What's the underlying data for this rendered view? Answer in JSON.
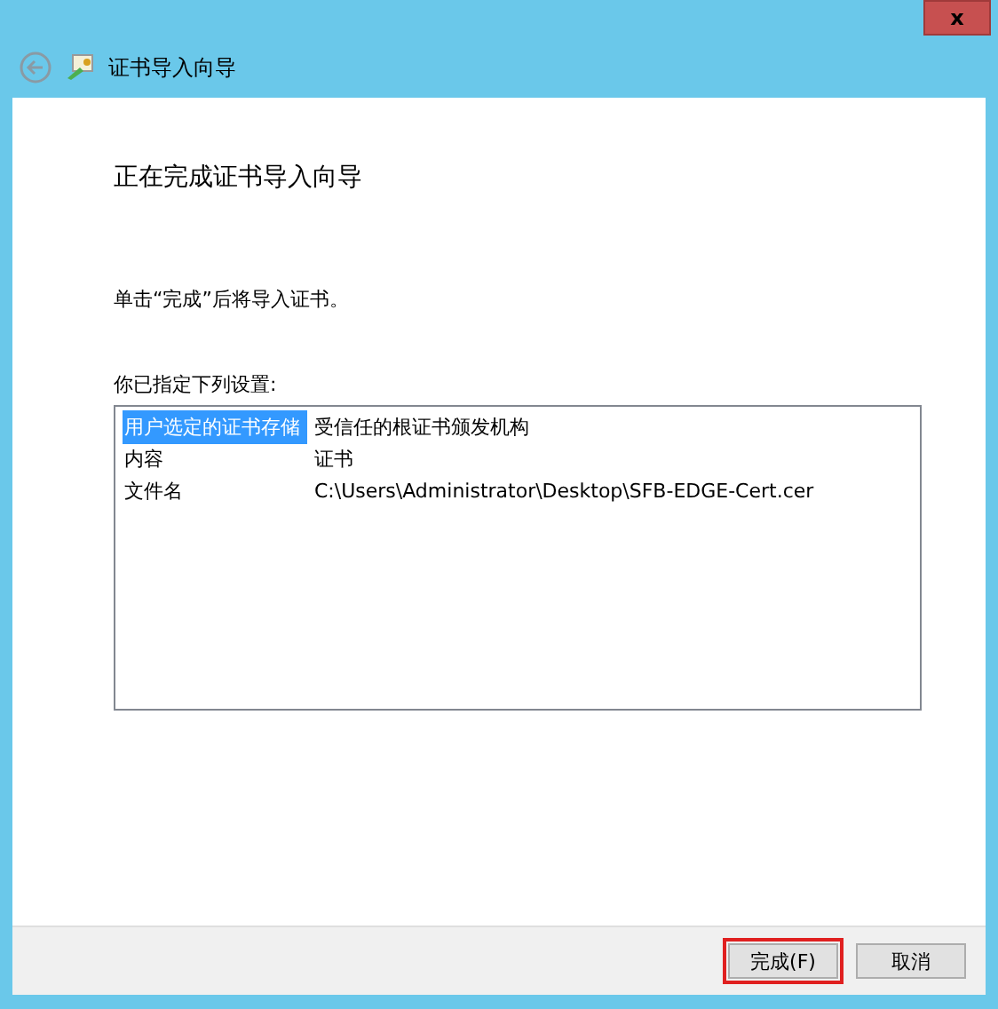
{
  "window": {
    "title": "证书导入向导",
    "close": "x"
  },
  "heading": "正在完成证书导入向导",
  "instruction": "单击“完成”后将导入证书。",
  "settings_label": "你已指定下列设置:",
  "settings": [
    {
      "name": "用户选定的证书存储",
      "value": "受信任的根证书颁发机构",
      "selected": true
    },
    {
      "name": "内容",
      "value": "证书",
      "selected": false
    },
    {
      "name": "文件名",
      "value": "C:\\Users\\Administrator\\Desktop\\SFB-EDGE-Cert.cer",
      "selected": false
    }
  ],
  "buttons": [
    {
      "label": "完成(F)",
      "highlighted": true
    },
    {
      "label": "取消",
      "highlighted": false
    }
  ]
}
